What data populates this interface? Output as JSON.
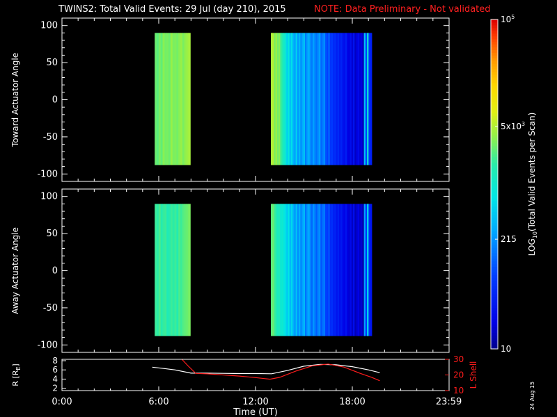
{
  "title": "TWINS2: Total Valid Events: 29 Jul (day 210), 2015",
  "note": "NOTE: Data Preliminary - Not validated",
  "date_stamp": "24 Aug 15",
  "chart_data": [
    {
      "type": "heatmap",
      "ylabel": "Toward Actuator Angle",
      "ylim": [
        -110,
        110
      ],
      "yticks": [
        100,
        50,
        0,
        -50,
        -100
      ],
      "xlim": [
        0,
        24
      ],
      "angle_range": [
        -88,
        90
      ],
      "data_segments": [
        {
          "start": 5.75,
          "end": 7.95,
          "log_values": [
            3.45,
            3.4,
            3.5,
            3.42,
            3.55,
            3.48,
            3.5,
            3.45,
            3.6,
            3.5,
            3.52,
            3.48,
            3.55,
            3.6,
            3.5,
            3.58,
            3.62,
            3.66
          ]
        },
        {
          "start": 12.95,
          "end": 19.2,
          "log_values": [
            3.68,
            3.7,
            3.5,
            3.62,
            3.48,
            3.55,
            3.3,
            3.2,
            3.05,
            2.95,
            2.7,
            2.9,
            2.6,
            2.8,
            2.5,
            2.4,
            2.7,
            2.35,
            2.55,
            2.3,
            2.45,
            2.6,
            2.2,
            2.38,
            2.5,
            2.3,
            2.2,
            2.4,
            2.25,
            2.15,
            2.3,
            2.4,
            2.1,
            2.2,
            2.3,
            2.0,
            1.9,
            2.1,
            1.8,
            1.85,
            1.7,
            1.75,
            1.6,
            1.7,
            1.55,
            1.65,
            1.5,
            1.45,
            1.6,
            1.35,
            1.3,
            1.45,
            1.25,
            1.5,
            1.2,
            1.3,
            1.4,
            1.25,
            1.3,
            1.15,
            2.6,
            1.9,
            3.0,
            1.8,
            1.6
          ]
        }
      ]
    },
    {
      "type": "heatmap",
      "ylabel": "Away Actuator Angle",
      "ylim": [
        -110,
        110
      ],
      "yticks": [
        100,
        50,
        0,
        -50,
        -100
      ],
      "xlim": [
        0,
        24
      ],
      "angle_range": [
        -88,
        90
      ],
      "data_segments": [
        {
          "start": 5.75,
          "end": 7.95,
          "log_values": [
            3.3,
            3.25,
            3.35,
            3.2,
            3.28,
            3.3,
            3.15,
            3.22,
            3.3,
            3.25,
            3.3,
            3.2,
            3.35,
            3.3,
            3.38,
            3.42,
            3.45,
            3.5
          ]
        },
        {
          "start": 12.95,
          "end": 19.2,
          "log_values": [
            3.4,
            3.45,
            3.3,
            3.2,
            3.1,
            3.15,
            2.95,
            3.0,
            2.9,
            2.8,
            2.65,
            2.85,
            2.55,
            2.75,
            2.5,
            2.35,
            2.6,
            2.3,
            2.5,
            2.25,
            2.4,
            2.55,
            2.15,
            2.35,
            2.45,
            2.25,
            2.1,
            2.35,
            2.2,
            2.05,
            2.25,
            2.3,
            2.0,
            2.15,
            2.2,
            1.9,
            1.85,
            2.0,
            1.7,
            1.75,
            1.6,
            1.65,
            1.5,
            1.6,
            1.45,
            1.55,
            1.4,
            1.35,
            1.5,
            1.3,
            1.25,
            1.4,
            1.2,
            1.45,
            1.15,
            1.25,
            1.35,
            1.2,
            1.25,
            1.1,
            2.4,
            1.8,
            2.8,
            1.7,
            1.5
          ]
        }
      ]
    },
    {
      "type": "line",
      "ylabel_left": "R [R",
      "ylabel_left_sub": "E",
      "ylabel_left_close": "]",
      "ylabel_right": "L Shell",
      "ylim_left": [
        1.5,
        8.3
      ],
      "ylim_right": [
        10,
        30
      ],
      "yticks_left": [
        2,
        4,
        6,
        8
      ],
      "yticks_right": [
        10,
        20,
        30
      ],
      "xlim": [
        0,
        24
      ],
      "series": [
        {
          "name": "R [RE]",
          "color": "#ffffff",
          "axis": "left",
          "x": [
            5.6,
            6.3,
            7.0,
            8.0,
            9.0,
            10.0,
            11.0,
            12.0,
            13.0,
            14.0,
            15.0,
            16.0,
            17.0,
            18.0,
            19.0,
            19.7
          ],
          "y": [
            6.6,
            6.3,
            6.0,
            5.3,
            5.3,
            5.25,
            5.2,
            5.2,
            5.15,
            5.9,
            6.8,
            7.2,
            7.1,
            6.7,
            6.0,
            5.4
          ]
        },
        {
          "name": "L Shell",
          "color": "#ff1c1c",
          "axis": "right",
          "x": [
            7.3,
            7.8,
            8.3,
            9.0,
            10.0,
            11.0,
            12.0,
            12.9,
            13.5,
            14.5,
            15.5,
            16.5,
            17.5,
            18.5,
            19.2,
            19.7
          ],
          "y": [
            31.5,
            26.0,
            21.0,
            20.7,
            20.0,
            19.3,
            18.3,
            17.3,
            18.5,
            22.5,
            25.8,
            27.0,
            25.0,
            21.0,
            18.5,
            16.3
          ]
        }
      ]
    }
  ],
  "xaxis": {
    "label": "Time (UT)",
    "ticks": [
      0,
      6,
      12,
      18,
      23.983
    ],
    "tick_labels": [
      "0:00",
      "6:00",
      "12:00",
      "18:00",
      "23:59"
    ]
  },
  "colorbar": {
    "log_range": [
      1,
      5
    ],
    "label": "LOG",
    "label_sub": "10",
    "label_rest": "(Total Valid Events per Scan)",
    "ticks": [
      {
        "log": 5,
        "label": "10",
        "sup": "5"
      },
      {
        "log": 3.699,
        "label": "5x10",
        "sup": "3"
      },
      {
        "log": 2.332,
        "label": "215",
        "sup": ""
      },
      {
        "log": 1,
        "label": "10",
        "sup": ""
      }
    ]
  }
}
